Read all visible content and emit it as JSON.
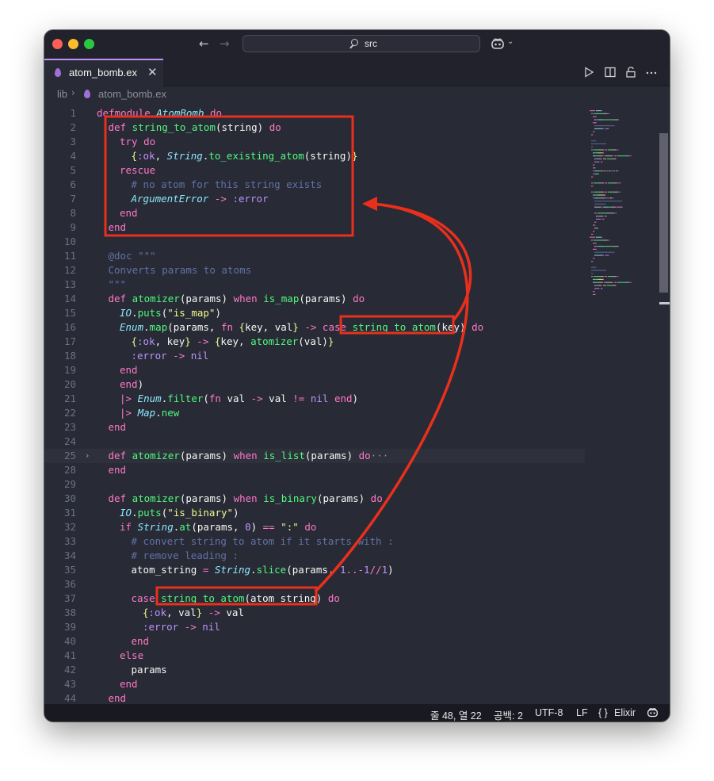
{
  "window": {
    "search_text": "src",
    "copilot_icon": "copilot-icon"
  },
  "tabs": [
    {
      "label": "atom_bomb.ex",
      "close": "✕",
      "active": true
    }
  ],
  "breadcrumb": {
    "folder": "lib",
    "separator": "›",
    "file": "atom_bomb.ex"
  },
  "editor_actions": [
    "run-icon",
    "split-editor-icon",
    "lock-icon",
    "more-icon"
  ],
  "code_lines": [
    {
      "n": "1",
      "indent": 0,
      "tokens": [
        [
          "k",
          "defmodule "
        ],
        [
          "m",
          "AtomBomb"
        ],
        [
          "k",
          " do"
        ]
      ]
    },
    {
      "n": "2",
      "indent": 1,
      "tokens": [
        [
          "k",
          "def "
        ],
        [
          "f",
          "string_to_atom"
        ],
        [
          "p",
          "(string) "
        ],
        [
          "k",
          "do"
        ]
      ]
    },
    {
      "n": "3",
      "indent": 2,
      "tokens": [
        [
          "k",
          "try do"
        ]
      ]
    },
    {
      "n": "4",
      "indent": 3,
      "tokens": [
        [
          "b",
          "{"
        ],
        [
          "a",
          ":ok"
        ],
        [
          "p",
          ", "
        ],
        [
          "m",
          "String"
        ],
        [
          "p",
          "."
        ],
        [
          "f",
          "to_existing_atom"
        ],
        [
          "p",
          "(string)"
        ],
        [
          "b",
          "}"
        ]
      ]
    },
    {
      "n": "5",
      "indent": 2,
      "tokens": [
        [
          "k",
          "rescue"
        ]
      ]
    },
    {
      "n": "6",
      "indent": 3,
      "tokens": [
        [
          "c",
          "# no atom for this string exists"
        ]
      ]
    },
    {
      "n": "7",
      "indent": 3,
      "tokens": [
        [
          "m",
          "ArgumentError"
        ],
        [
          "o",
          " -> "
        ],
        [
          "a",
          ":error"
        ]
      ]
    },
    {
      "n": "8",
      "indent": 2,
      "tokens": [
        [
          "k",
          "end"
        ]
      ]
    },
    {
      "n": "9",
      "indent": 1,
      "tokens": [
        [
          "k",
          "end"
        ]
      ]
    },
    {
      "n": "10",
      "indent": 0,
      "tokens": []
    },
    {
      "n": "11",
      "indent": 1,
      "tokens": [
        [
          "d",
          "@doc \"\"\""
        ]
      ]
    },
    {
      "n": "12",
      "indent": 1,
      "tokens": [
        [
          "d",
          "Converts params to atoms"
        ]
      ]
    },
    {
      "n": "13",
      "indent": 1,
      "tokens": [
        [
          "d",
          "\"\"\""
        ]
      ]
    },
    {
      "n": "14",
      "indent": 1,
      "tokens": [
        [
          "k",
          "def "
        ],
        [
          "f",
          "atomizer"
        ],
        [
          "p",
          "(params) "
        ],
        [
          "k",
          "when "
        ],
        [
          "f",
          "is_map"
        ],
        [
          "p",
          "(params) "
        ],
        [
          "k",
          "do"
        ]
      ]
    },
    {
      "n": "15",
      "indent": 2,
      "tokens": [
        [
          "m",
          "IO"
        ],
        [
          "p",
          "."
        ],
        [
          "f",
          "puts"
        ],
        [
          "p",
          "("
        ],
        [
          "s",
          "\"is_map\""
        ],
        [
          "p",
          ")"
        ]
      ]
    },
    {
      "n": "16",
      "indent": 2,
      "tokens": [
        [
          "m",
          "Enum"
        ],
        [
          "p",
          "."
        ],
        [
          "f",
          "map"
        ],
        [
          "p",
          "(params, "
        ],
        [
          "k",
          "fn "
        ],
        [
          "b",
          "{"
        ],
        [
          "p",
          "key, val"
        ],
        [
          "b",
          "}"
        ],
        [
          "o",
          " -> "
        ],
        [
          "k",
          "case "
        ],
        [
          "f",
          "string_to_atom"
        ],
        [
          "p",
          "(key) "
        ],
        [
          "k",
          "do"
        ]
      ]
    },
    {
      "n": "17",
      "indent": 3,
      "tokens": [
        [
          "b",
          "{"
        ],
        [
          "a",
          ":ok"
        ],
        [
          "p",
          ", key"
        ],
        [
          "b",
          "}"
        ],
        [
          "o",
          " -> "
        ],
        [
          "b",
          "{"
        ],
        [
          "p",
          "key, "
        ],
        [
          "f",
          "atomizer"
        ],
        [
          "p",
          "(val)"
        ],
        [
          "b",
          "}"
        ]
      ]
    },
    {
      "n": "18",
      "indent": 3,
      "tokens": [
        [
          "a",
          ":error"
        ],
        [
          "o",
          " -> "
        ],
        [
          "a",
          "nil"
        ]
      ]
    },
    {
      "n": "19",
      "indent": 2,
      "tokens": [
        [
          "k",
          "end"
        ]
      ]
    },
    {
      "n": "20",
      "indent": 2,
      "tokens": [
        [
          "k",
          "end"
        ],
        [
          "p",
          ")"
        ]
      ]
    },
    {
      "n": "21",
      "indent": 2,
      "tokens": [
        [
          "o",
          "|> "
        ],
        [
          "m",
          "Enum"
        ],
        [
          "p",
          "."
        ],
        [
          "f",
          "filter"
        ],
        [
          "p",
          "("
        ],
        [
          "k",
          "fn "
        ],
        [
          "p",
          "val "
        ],
        [
          "o",
          "-> "
        ],
        [
          "p",
          "val "
        ],
        [
          "o",
          "!= "
        ],
        [
          "a",
          "nil "
        ],
        [
          "k",
          "end"
        ],
        [
          "p",
          ")"
        ]
      ]
    },
    {
      "n": "22",
      "indent": 2,
      "tokens": [
        [
          "o",
          "|> "
        ],
        [
          "m",
          "Map"
        ],
        [
          "p",
          "."
        ],
        [
          "f",
          "new"
        ]
      ]
    },
    {
      "n": "23",
      "indent": 1,
      "tokens": [
        [
          "k",
          "end"
        ]
      ]
    },
    {
      "n": "24",
      "indent": 0,
      "tokens": []
    },
    {
      "n": "25",
      "indent": 1,
      "folded": true,
      "tokens": [
        [
          "k",
          "def "
        ],
        [
          "f",
          "atomizer"
        ],
        [
          "p",
          "(params) "
        ],
        [
          "k",
          "when "
        ],
        [
          "f",
          "is_list"
        ],
        [
          "p",
          "(params) "
        ],
        [
          "k",
          "do"
        ],
        [
          "fold-dots",
          "···"
        ]
      ]
    },
    {
      "n": "28",
      "indent": 1,
      "tokens": [
        [
          "k",
          "end"
        ]
      ]
    },
    {
      "n": "29",
      "indent": 0,
      "tokens": []
    },
    {
      "n": "30",
      "indent": 1,
      "tokens": [
        [
          "k",
          "def "
        ],
        [
          "f",
          "atomizer"
        ],
        [
          "p",
          "(params) "
        ],
        [
          "k",
          "when "
        ],
        [
          "f",
          "is_binary"
        ],
        [
          "p",
          "(params) "
        ],
        [
          "k",
          "do"
        ]
      ]
    },
    {
      "n": "31",
      "indent": 2,
      "tokens": [
        [
          "m",
          "IO"
        ],
        [
          "p",
          "."
        ],
        [
          "f",
          "puts"
        ],
        [
          "p",
          "("
        ],
        [
          "s",
          "\"is_binary\""
        ],
        [
          "p",
          ")"
        ]
      ]
    },
    {
      "n": "32",
      "indent": 2,
      "tokens": [
        [
          "k",
          "if "
        ],
        [
          "m",
          "String"
        ],
        [
          "p",
          "."
        ],
        [
          "f",
          "at"
        ],
        [
          "p",
          "(params, "
        ],
        [
          "a",
          "0"
        ],
        [
          "p",
          ") "
        ],
        [
          "o",
          "== "
        ],
        [
          "s",
          "\":\" "
        ],
        [
          "k",
          "do"
        ]
      ]
    },
    {
      "n": "33",
      "indent": 3,
      "tokens": [
        [
          "c",
          "# convert string to atom if it starts with :"
        ]
      ]
    },
    {
      "n": "34",
      "indent": 3,
      "tokens": [
        [
          "c",
          "# remove leading :"
        ]
      ]
    },
    {
      "n": "35",
      "indent": 3,
      "tokens": [
        [
          "p",
          "atom_string "
        ],
        [
          "o",
          "= "
        ],
        [
          "m",
          "String"
        ],
        [
          "p",
          "."
        ],
        [
          "f",
          "slice"
        ],
        [
          "p",
          "(params, "
        ],
        [
          "a",
          "1"
        ],
        [
          "o",
          "..-"
        ],
        [
          "a",
          "1"
        ],
        [
          "o",
          "//"
        ],
        [
          "a",
          "1"
        ],
        [
          "p",
          ")"
        ]
      ]
    },
    {
      "n": "36",
      "indent": 0,
      "tokens": []
    },
    {
      "n": "37",
      "indent": 3,
      "tokens": [
        [
          "k",
          "case "
        ],
        [
          "f",
          "string_to_atom"
        ],
        [
          "p",
          "(atom_string) "
        ],
        [
          "k",
          "do"
        ]
      ]
    },
    {
      "n": "38",
      "indent": 4,
      "tokens": [
        [
          "b",
          "{"
        ],
        [
          "a",
          ":ok"
        ],
        [
          "p",
          ", val"
        ],
        [
          "b",
          "}"
        ],
        [
          "o",
          " -> "
        ],
        [
          "p",
          "val"
        ]
      ]
    },
    {
      "n": "39",
      "indent": 4,
      "tokens": [
        [
          "a",
          ":error"
        ],
        [
          "o",
          " -> "
        ],
        [
          "a",
          "nil"
        ]
      ]
    },
    {
      "n": "40",
      "indent": 3,
      "tokens": [
        [
          "k",
          "end"
        ]
      ]
    },
    {
      "n": "41",
      "indent": 2,
      "tokens": [
        [
          "k",
          "else"
        ]
      ]
    },
    {
      "n": "42",
      "indent": 3,
      "tokens": [
        [
          "p",
          "params"
        ]
      ]
    },
    {
      "n": "43",
      "indent": 2,
      "tokens": [
        [
          "k",
          "end"
        ]
      ]
    },
    {
      "n": "44",
      "indent": 1,
      "tokens": [
        [
          "k",
          "end"
        ]
      ]
    }
  ],
  "status": {
    "position": "줄 48, 열 22",
    "spaces": "공백: 2",
    "encoding": "UTF-8",
    "eol": "LF",
    "braces": "{ }",
    "language": "Elixir"
  },
  "annotation_colors": {
    "highlight": "#e8301c"
  }
}
